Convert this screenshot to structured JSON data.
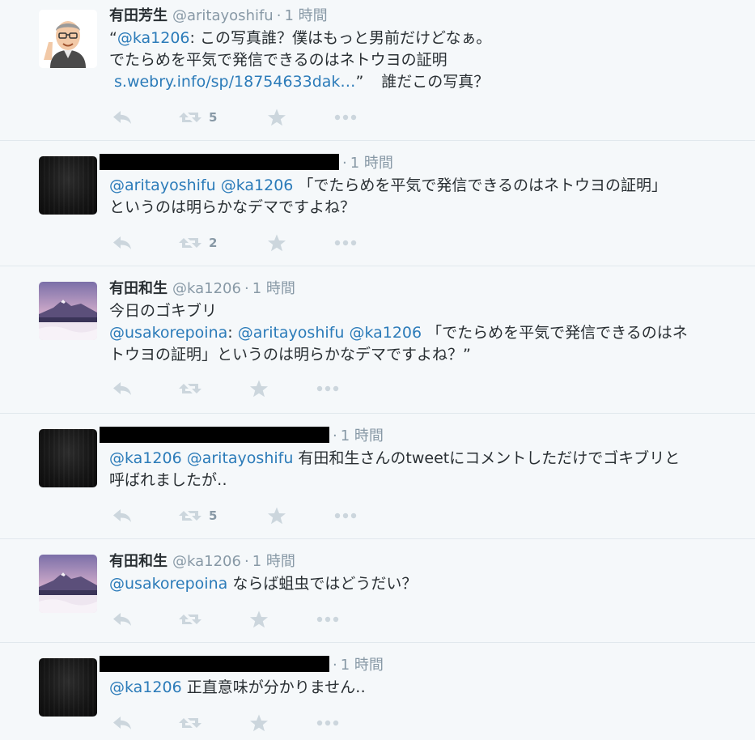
{
  "tweets": [
    {
      "fullname": "有田芳生",
      "screen_name": "@aritayoshifu",
      "separator": "·",
      "time": "1 時間",
      "line1_quote_open": "“",
      "line1_mention": "@ka1206",
      "line1_rest": ": この写真誰？僕はもっと男前だけどなぁ。",
      "line2": "でたらめを平気で発信できるのはネトウヨの証明",
      "line3_link": "s.webry.info/sp/18754633dak…",
      "line3_quote_close": "”",
      "line3_rest": "誰だこの写真？",
      "retweet_count": "5"
    },
    {
      "fullname": "",
      "screen_name": "",
      "separator": "·",
      "time": "1 時間",
      "line1_mention_a": "@aritayoshifu",
      "line1_mention_b": "@ka1206",
      "line1_rest": " 「でたらめを平気で発信できるのはネトウヨの証明」",
      "line2": "というのは明らかなデマですよね？",
      "retweet_count": "2"
    },
    {
      "fullname": "有田和生",
      "screen_name": "@ka1206",
      "separator": "·",
      "time": "1 時間",
      "line1": "今日のゴキブリ",
      "line2_mention_a": "@usakorepoina",
      "line2_colon": ": ",
      "line2_mention_b": "@aritayoshifu",
      "line2_mention_c": "@ka1206",
      "line2_rest": " 「でたらめを平気で発信できるのはネ",
      "line3": "トウヨの証明」というのは明らかなデマですよね？”",
      "retweet_count": ""
    },
    {
      "fullname": "",
      "screen_name": "",
      "separator": "·",
      "time": "1 時間",
      "line1_mention_a": "@ka1206",
      "line1_mention_b": "@aritayoshifu",
      "line1_rest": " 有田和生さんのtweetにコメントしただけでゴキブリと",
      "line2": "呼ばれましたが‥",
      "retweet_count": "5"
    },
    {
      "fullname": "有田和生",
      "screen_name": "@ka1206",
      "separator": "·",
      "time": "1 時間",
      "line1_mention": "@usakorepoina",
      "line1_rest": " ならば蛆虫ではどうだい？",
      "retweet_count": ""
    },
    {
      "fullname": "",
      "screen_name": "",
      "separator": "·",
      "time": "1 時間",
      "line1_mention": "@ka1206",
      "line1_rest": " 正直意味が分かりません‥",
      "retweet_count": ""
    }
  ],
  "icons": {
    "reply": "reply-icon",
    "retweet": "retweet-icon",
    "favorite": "star-icon",
    "more": "more-icon"
  },
  "colors": {
    "link": "#2b7bb9",
    "meta": "#8899a6",
    "action_icon": "#ccd6dd",
    "background": "#f5f8fa"
  }
}
